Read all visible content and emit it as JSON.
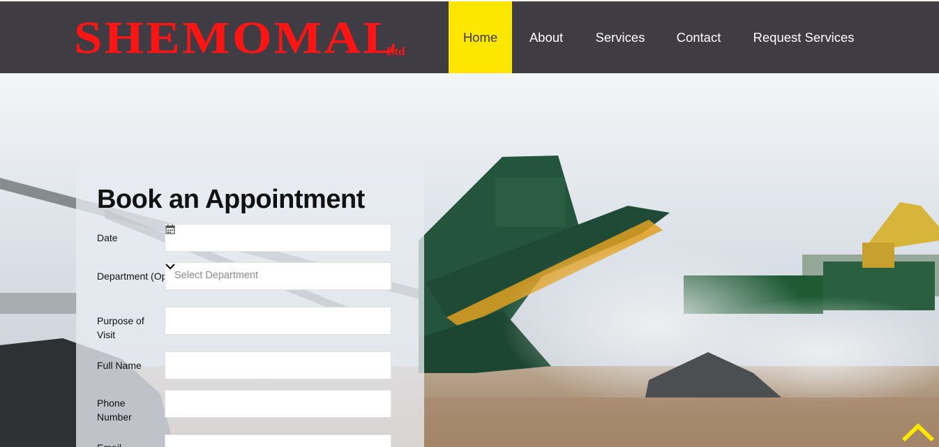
{
  "brand": {
    "name": "SHEMOMAL",
    "suffix": "Ltd",
    "color": "#ff1414"
  },
  "nav": {
    "items": [
      {
        "label": "Home",
        "active": true
      },
      {
        "label": "About",
        "active": false
      },
      {
        "label": "Services",
        "active": false
      },
      {
        "label": "Contact",
        "active": false
      },
      {
        "label": "Request Services",
        "active": false
      }
    ],
    "active_color": "#fde600",
    "background": "#3f3d43"
  },
  "form": {
    "title": "Book an Appointment",
    "fields": {
      "date": {
        "label": "Date",
        "value": "",
        "icon": "calendar-icon"
      },
      "department": {
        "label": "Department (Optional)",
        "placeholder": "Select Department",
        "icon": "chevron-down-icon"
      },
      "purpose": {
        "label": "Purpose of Visit",
        "value": ""
      },
      "full_name": {
        "label": "Full Name",
        "value": ""
      },
      "phone": {
        "label": "Phone Number",
        "value": ""
      },
      "email": {
        "label": "Email",
        "value": ""
      }
    }
  },
  "scroll_top": {
    "icon": "chevron-up-icon",
    "color": "#fde600"
  }
}
